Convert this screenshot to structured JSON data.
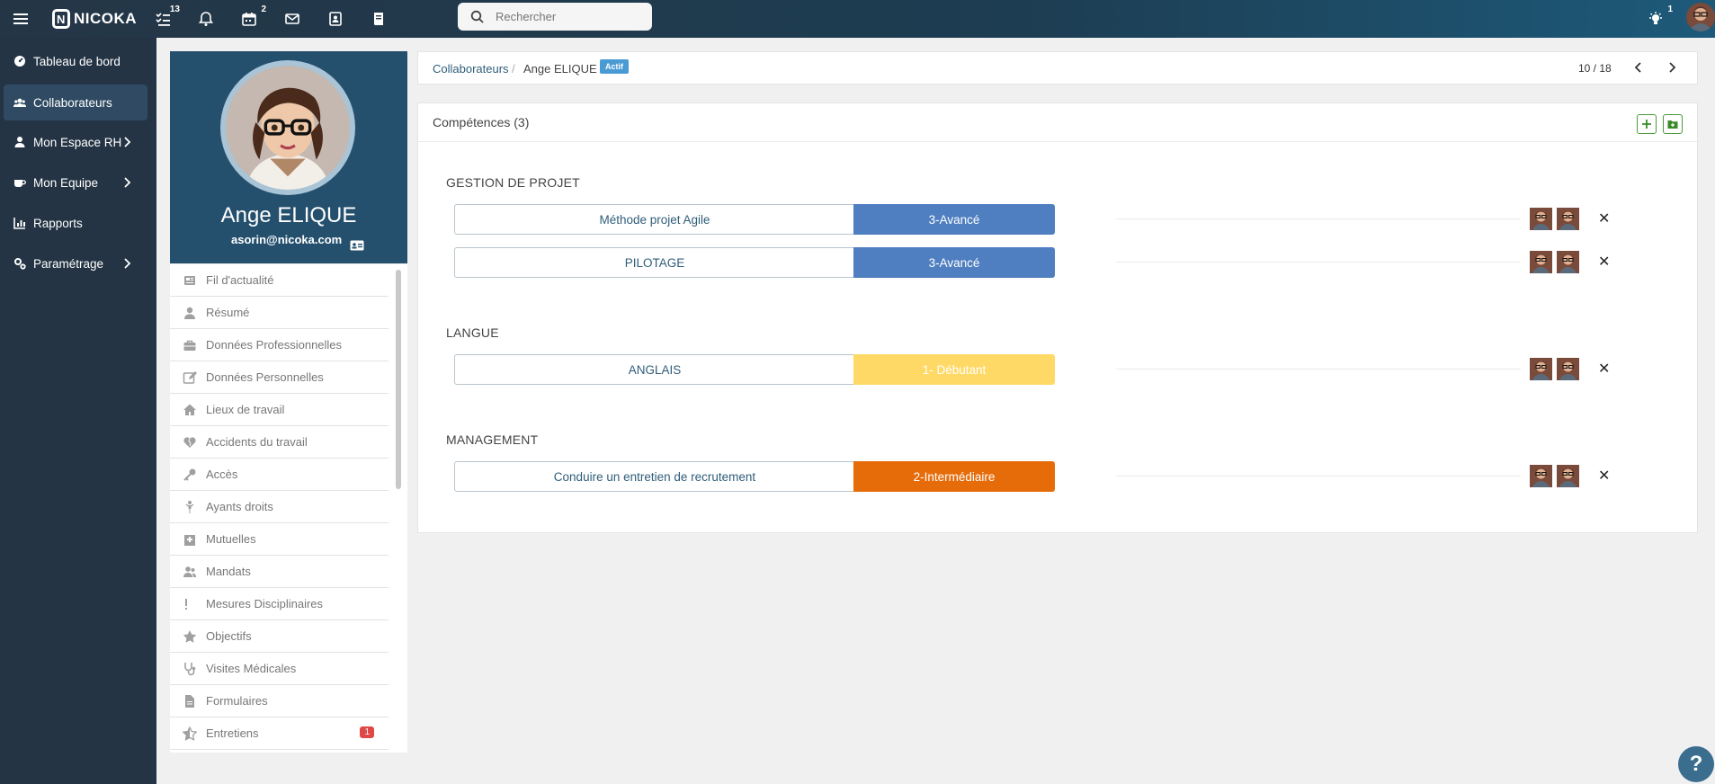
{
  "app": {
    "logo_text": "NICOKA"
  },
  "topbar": {
    "search_placeholder": "Rechercher",
    "badges": {
      "tasks": "13",
      "calendar": "2",
      "notifications_right": "1"
    }
  },
  "sidebar": {
    "items": [
      {
        "label": "Tableau de bord",
        "icon": "dashboard-icon"
      },
      {
        "label": "Collaborateurs",
        "icon": "users-icon",
        "active": true
      },
      {
        "label": "Mon Espace RH",
        "icon": "user-icon",
        "expandable": true
      },
      {
        "label": "Mon Equipe",
        "icon": "coffee-icon",
        "expandable": true
      },
      {
        "label": "Rapports",
        "icon": "chart-icon"
      },
      {
        "label": "Paramétrage",
        "icon": "cogs-icon",
        "expandable": true
      }
    ]
  },
  "profile": {
    "name": "Ange ELIQUE",
    "email": "asorin@nicoka.com"
  },
  "profile_menu": {
    "items": [
      {
        "label": "Fil d'actualité"
      },
      {
        "label": "Résumé"
      },
      {
        "label": "Données Professionnelles"
      },
      {
        "label": "Données Personnelles"
      },
      {
        "label": "Lieux de travail"
      },
      {
        "label": "Accidents du travail"
      },
      {
        "label": "Accès"
      },
      {
        "label": "Ayants droits"
      },
      {
        "label": "Mutuelles"
      },
      {
        "label": "Mandats"
      },
      {
        "label": "Mesures Disciplinaires"
      },
      {
        "label": "Objectifs"
      },
      {
        "label": "Visites Médicales"
      },
      {
        "label": "Formulaires"
      },
      {
        "label": "Entretiens",
        "badge": "1"
      }
    ]
  },
  "breadcrumb": {
    "root": "Collaborateurs",
    "separator": "/",
    "current": "Ange ELIQUE",
    "status": "Actif",
    "pager": "10 / 18"
  },
  "competences": {
    "title": "Compétences (3)",
    "groups": [
      {
        "title": "GESTION DE PROJET",
        "skills": [
          {
            "name": "Méthode projet Agile",
            "level": "3-Avancé",
            "color": "#4f7fc0"
          },
          {
            "name": "PILOTAGE",
            "level": "3-Avancé",
            "color": "#4f7fc0"
          }
        ]
      },
      {
        "title": "LANGUE",
        "skills": [
          {
            "name": "ANGLAIS",
            "level": "1- Débutant",
            "color": "#ffd966"
          }
        ]
      },
      {
        "title": "MANAGEMENT",
        "skills": [
          {
            "name": "Conduire un entretien de recrutement",
            "level": "2-Intermédiaire",
            "color": "#e66c0a"
          }
        ]
      }
    ]
  },
  "help": {
    "label": "?"
  }
}
